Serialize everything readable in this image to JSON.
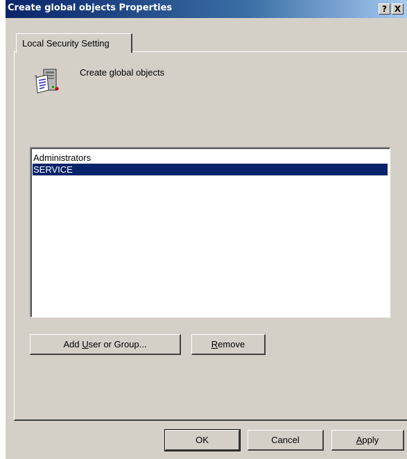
{
  "window": {
    "title": "Create global objects Properties",
    "help_button": "?",
    "close_button": "X"
  },
  "tabs": [
    {
      "label": "Local Security Setting",
      "active": true
    }
  ],
  "policy": {
    "icon": "policy-icon",
    "name": "Create global objects"
  },
  "principals": {
    "items": [
      {
        "label": "Administrators",
        "selected": false
      },
      {
        "label": "SERVICE",
        "selected": true
      }
    ]
  },
  "buttons": {
    "add": {
      "before": "Add ",
      "mnemonic": "U",
      "after": "ser or Group..."
    },
    "remove": {
      "before": "",
      "mnemonic": "R",
      "after": "emove"
    },
    "ok": "OK",
    "cancel": "Cancel",
    "apply": {
      "before": "",
      "mnemonic": "A",
      "after": "pply"
    }
  },
  "colors": {
    "title_gradient_start": "#0a246a",
    "title_gradient_end": "#a6caf0",
    "dialog_face": "#d4d0c8",
    "selection": "#0a246a"
  }
}
